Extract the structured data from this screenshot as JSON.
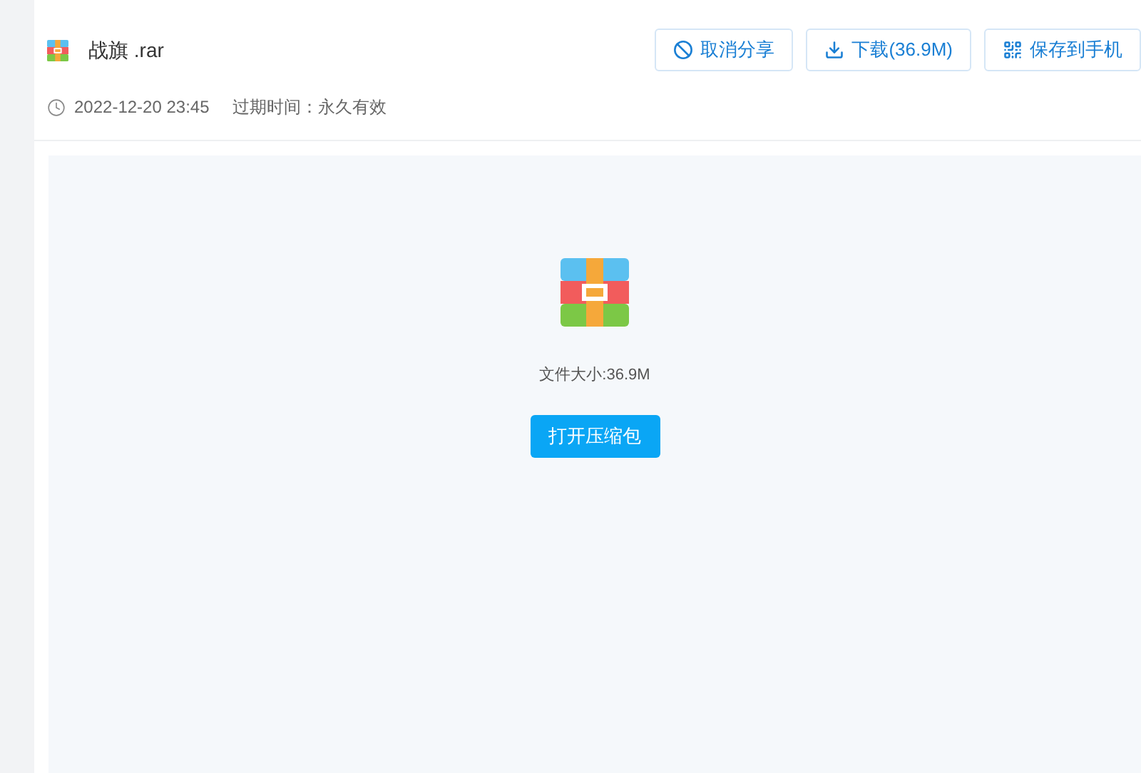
{
  "file": {
    "name": "战旗 .rar",
    "date": "2022-12-20 23:45",
    "expiry": "过期时间：永久有效"
  },
  "actions": [
    "取消分享",
    "下载(36.9M)",
    "保存到手机"
  ],
  "preview": {
    "size": "文件大小:36.9M",
    "button": "打开压缩包"
  }
}
